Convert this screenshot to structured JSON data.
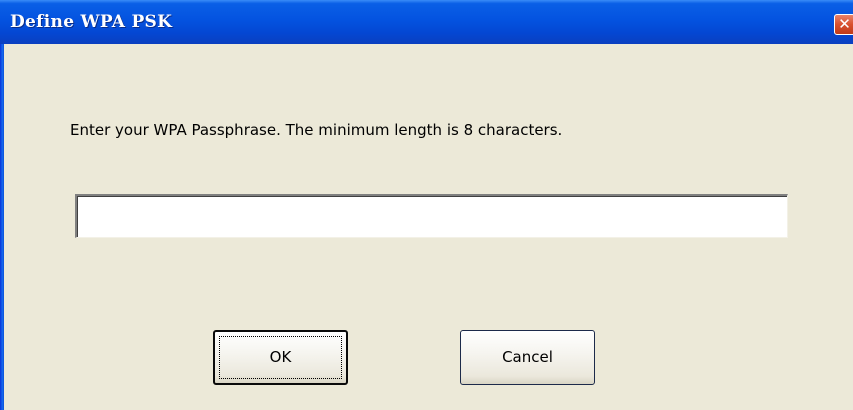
{
  "window": {
    "title": "Define WPA PSK",
    "close_glyph": "✕"
  },
  "dialog": {
    "prompt": "Enter your WPA Passphrase.  The minimum length is 8 characters.",
    "passphrase_value": "",
    "passphrase_placeholder": ""
  },
  "buttons": {
    "ok_label": "OK",
    "cancel_label": "Cancel"
  },
  "colors": {
    "titlebar": "#0453e0",
    "dialog_background": "#ece9d8",
    "close_button": "#d8502e"
  },
  "icons": {
    "close": "close-icon"
  }
}
